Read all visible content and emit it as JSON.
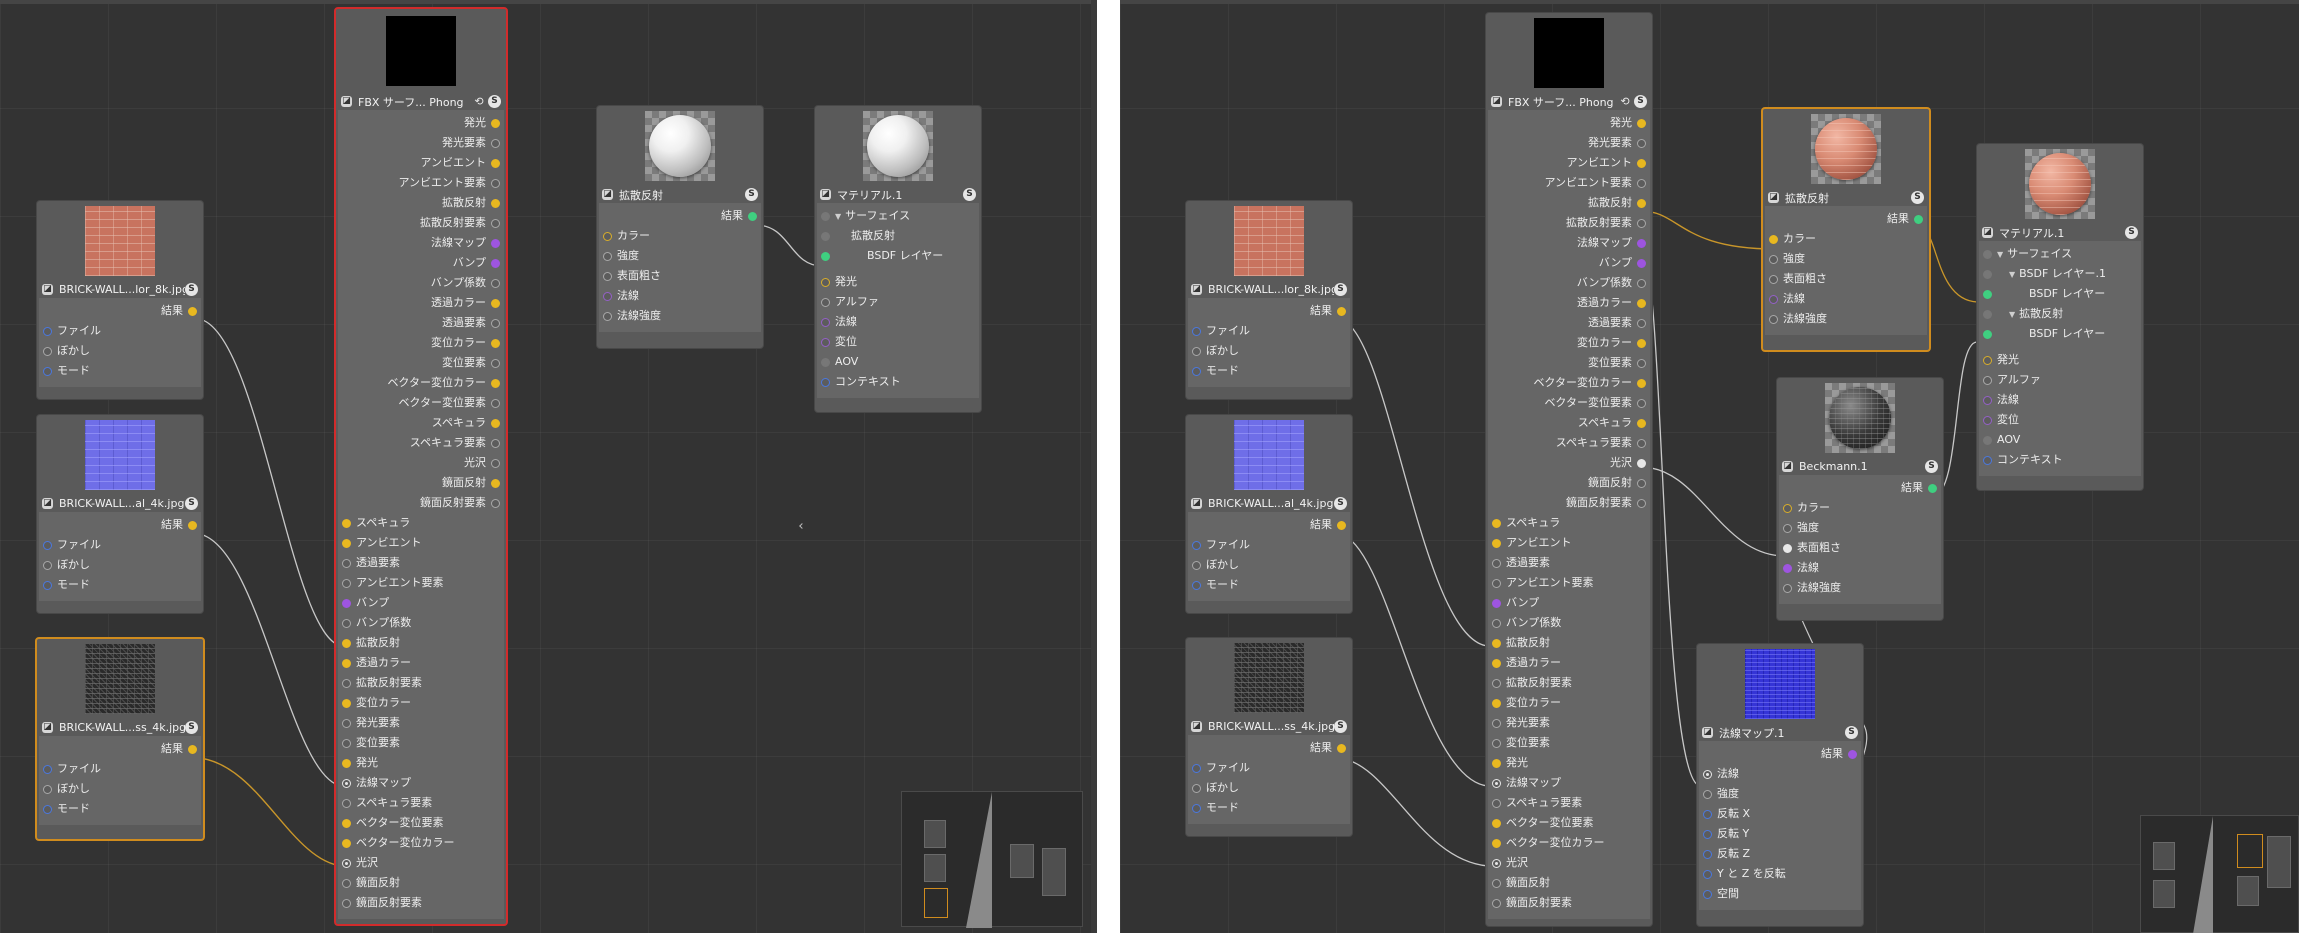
{
  "fbx_node": {
    "title": "FBX サーフ... Phong",
    "reset_glyph": "⟲",
    "badge": "S",
    "outputs": [
      "発光",
      "発光要素",
      "アンビエント",
      "アンビエント要素",
      "拡散反射",
      "拡散反射要素",
      "法線マップ",
      "バンプ",
      "バンプ係数",
      "透過カラー",
      "透過要素",
      "変位カラー",
      "変位要素",
      "ベクター変位カラー",
      "ベクター変位要素",
      "スペキュラ",
      "スペキュラ要素",
      "光沢",
      "鏡面反射",
      "鏡面反射要素"
    ],
    "inputs": [
      "スペキュラ",
      "アンビエント",
      "透過要素",
      "アンビエント要素",
      "バンプ",
      "バンプ係数",
      "拡散反射",
      "透過カラー",
      "拡散反射要素",
      "変位カラー",
      "発光要素",
      "変位要素",
      "発光",
      "法線マップ",
      "スペキュラ要素",
      "ベクター変位要素",
      "ベクター変位カラー",
      "光沢",
      "鏡面反射",
      "鏡面反射要素"
    ]
  },
  "texture_nodes": [
    {
      "title": "BRICK-WALL...lor_8k.jpg"
    },
    {
      "title": "BRICK-WALL...al_4k.jpg"
    },
    {
      "title": "BRICK-WALL...ss_4k.jpg"
    }
  ],
  "texture_rows": {
    "result": "結果",
    "file": "ファイル",
    "blur": "ぼかし",
    "mode": "モード"
  },
  "diffuse_node": {
    "title": "拡散反射",
    "result": "結果",
    "inputs": [
      "カラー",
      "強度",
      "表面粗さ",
      "法線",
      "法線強度"
    ]
  },
  "material_left": {
    "title": "マテリアル.1",
    "tree": [
      "サーフェイス",
      "拡散反射",
      "BSDF レイヤー"
    ],
    "inputs": [
      "発光",
      "アルファ",
      "法線",
      "変位",
      "AOV",
      "コンテキスト"
    ]
  },
  "material_right": {
    "title": "マテリアル.1",
    "tree": [
      "サーフェイス",
      "BSDF レイヤー.1",
      "BSDF レイヤー",
      "拡散反射",
      "BSDF レイヤー"
    ],
    "inputs": [
      "発光",
      "アルファ",
      "法線",
      "変位",
      "AOV",
      "コンテキスト"
    ]
  },
  "beckmann_node": {
    "title": "Beckmann.1",
    "result": "結果",
    "inputs": [
      "カラー",
      "強度",
      "表面粗さ",
      "法線",
      "法線強度"
    ]
  },
  "normalmap_node": {
    "title": "法線マップ.1",
    "result": "結果",
    "inputs": [
      "法線",
      "強度",
      "反転 X",
      "反転 Y",
      "反転 Z",
      "Y と Z を反転",
      "空間"
    ]
  },
  "badge_label": "S",
  "colors": {
    "wire_gold": "#c9962a",
    "wire_grey": "#c8c8c8",
    "selection_orange": "#d08c1e",
    "selection_red": "#d22b2b"
  }
}
